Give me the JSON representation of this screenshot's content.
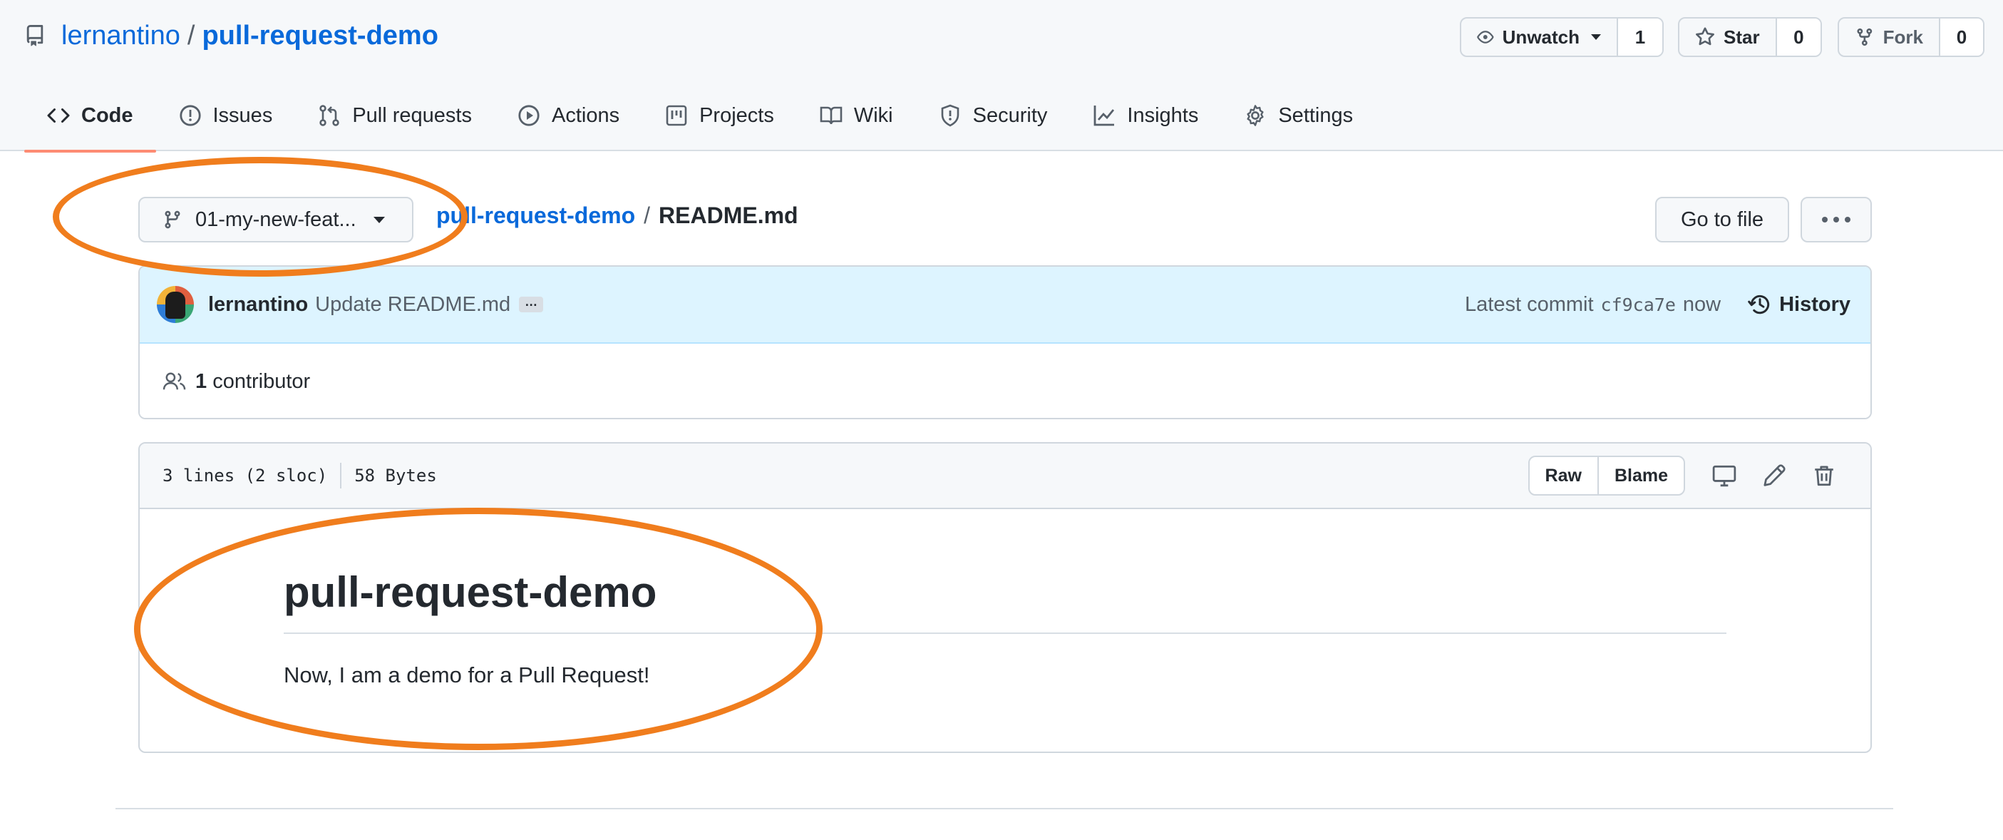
{
  "repo": {
    "owner": "lernantino",
    "separator": "/",
    "name": "pull-request-demo"
  },
  "header_actions": {
    "unwatch_label": "Unwatch",
    "unwatch_count": "1",
    "star_label": "Star",
    "star_count": "0",
    "fork_label": "Fork",
    "fork_count": "0"
  },
  "tabs": [
    {
      "label": "Code",
      "icon": "code-icon",
      "active": true
    },
    {
      "label": "Issues",
      "icon": "issue-icon"
    },
    {
      "label": "Pull requests",
      "icon": "pull-request-icon"
    },
    {
      "label": "Actions",
      "icon": "play-icon"
    },
    {
      "label": "Projects",
      "icon": "project-icon"
    },
    {
      "label": "Wiki",
      "icon": "book-icon"
    },
    {
      "label": "Security",
      "icon": "shield-icon"
    },
    {
      "label": "Insights",
      "icon": "graph-icon"
    },
    {
      "label": "Settings",
      "icon": "gear-icon"
    }
  ],
  "file_nav": {
    "branch": "01-my-new-feat...",
    "breadcrumb_repo": "pull-request-demo",
    "breadcrumb_sep": "/",
    "breadcrumb_file": "README.md",
    "go_to_file": "Go to file"
  },
  "commit": {
    "author": "lernantino",
    "message": "Update README.md",
    "ellipsis": "…",
    "latest_label": "Latest commit",
    "sha": "cf9ca7e",
    "time": "now",
    "history_label": "History"
  },
  "contributors": {
    "count": "1",
    "label": "contributor"
  },
  "file_info": {
    "lines": "3 lines (2 sloc)",
    "size": "58 Bytes",
    "raw_label": "Raw",
    "blame_label": "Blame"
  },
  "readme": {
    "heading": "pull-request-demo",
    "body": "Now, I am a demo for a Pull Request!"
  },
  "colors": {
    "link": "#0969da",
    "annotation": "#f07d1d",
    "active_tab_underline": "#fd8c73",
    "commit_bg": "#ddf4ff"
  }
}
